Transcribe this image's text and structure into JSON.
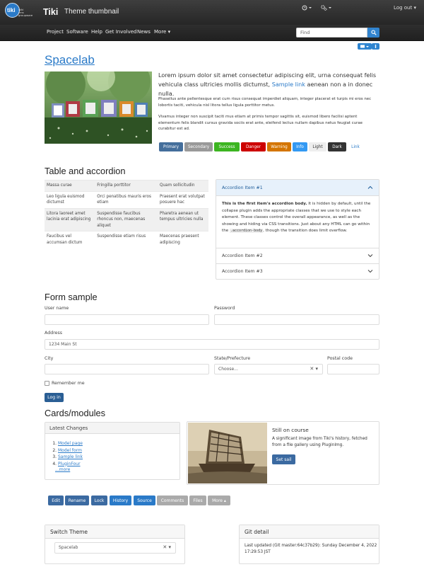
{
  "header": {
    "logo_text": "tiki",
    "logo_sub": "wiki\ncms\ngroupware",
    "brand": "Tiki",
    "site_title": "Theme thumbnail",
    "clock_icon": "clock-icon",
    "settings_icon": "gear-icon",
    "logout": "Log out"
  },
  "nav": {
    "items": [
      "Project",
      "Software",
      "Help",
      "Get Involved",
      "News",
      "More"
    ],
    "search_placeholder": "Find"
  },
  "content": {
    "title": "Spacelab",
    "lead_pre": "Lorem ipsum dolor sit amet consectetur adipiscing elit, urna consequat felis vehicula class ultricies mollis dictumst, ",
    "lead_link": "Sample link",
    "lead_post": " aenean non a in donec nulla.",
    "p1": "Phasellus ante pellentesque erat cum risus consequat imperdiet aliquam, integer placerat et turpis mi eros nec lobortis taciti, vehicula nisl litora tellus ligula porttitor metus.",
    "p2": "Vivamus integer non suscipit taciti mus etiam at primis tempor sagittis sit, euismod libero facilisi aptent elementum felis blandit cursus gravida sociis erat ante, eleifend lectus nullam dapibus netus feugiat curae curabitur est ad.",
    "buttons": [
      "Primary",
      "Secondary",
      "Success",
      "Danger",
      "Warning",
      "Info",
      "Light",
      "Dark",
      "Link"
    ]
  },
  "table_section": {
    "heading": "Table and accordion",
    "rows": [
      [
        "Massa curae",
        "Fringilla porttitor",
        "Quam sollicitudin"
      ],
      [
        "Leo ligula euismod dictumst",
        "Orci penatibus mauris eros etiam",
        "Praesent erat volutpat posuere hac"
      ],
      [
        "Litora laoreet amet lacinia erat adipiscing",
        "Suspendisse faucibus rhoncus non, maecenas aliquet",
        "Pharetra aenean ut tempus ultricies nulla"
      ],
      [
        "Faucibus vel accumsan dictum",
        "Suspendisse etiam risus",
        "Maecenas praesent adipiscing"
      ]
    ],
    "accordion": {
      "item1": "Accordion Item #1",
      "body_strong": "This is the first item's accordion body.",
      "body1": " It is hidden by default, until the collapse plugin adds the appropriate classes that we use to style each element. These classes control the overall appearance, as well as the showing and hiding via CSS transitions. Just about any HTML can go within the ",
      "body_code": ".accordion-body",
      "body2": ", though the transition does limit overflow.",
      "item2": "Accordion Item #2",
      "item3": "Accordion Item #3"
    }
  },
  "form": {
    "heading": "Form sample",
    "user_label": "User name",
    "password_label": "Password",
    "address_label": "Address",
    "address_placeholder": "1234 Main St",
    "city_label": "City",
    "state_label": "State/Prefecture",
    "state_value": "Choose...",
    "postal_label": "Postal code",
    "remember": "Remember me",
    "login": "Log in"
  },
  "cards": {
    "heading": "Cards/modules",
    "latest_title": "Latest Changes",
    "latest_items": [
      "Model page",
      "Model form",
      "Sample link",
      "PluginFour"
    ],
    "more": "...more",
    "card_title": "Still on course",
    "card_text": "A significant image from Tiki's history, fetched from a file gallery using PluginImg.",
    "card_button": "Set sail"
  },
  "actions": [
    "Edit",
    "Rename",
    "Lock",
    "History",
    "Source",
    "Comments",
    "Files",
    "More"
  ],
  "modules": {
    "switch_title": "Switch Theme",
    "switch_value": "Spacelab",
    "git_title": "Git detail",
    "git_text": "Last updated (Git master:64c37b29): Sunday December 4, 2022 17:29:53 JST"
  }
}
